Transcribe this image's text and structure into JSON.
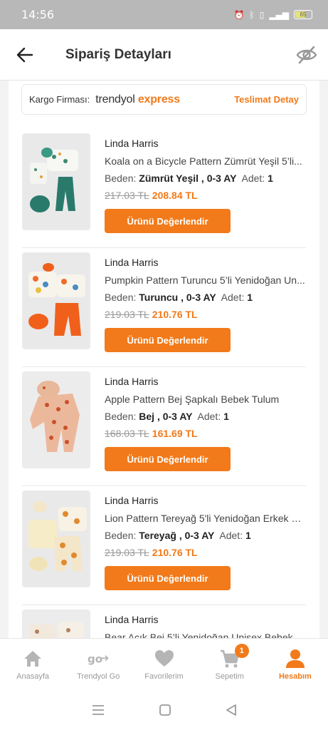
{
  "status_bar": {
    "time": "14:56",
    "battery": "65"
  },
  "header": {
    "title": "Sipariş Detayları"
  },
  "cargo": {
    "label": "Kargo Firması:",
    "brand_part1": "trendyol",
    "brand_part2": "express",
    "delivery_link": "Teslimat Detay"
  },
  "products": [
    {
      "seller": "Linda Harris",
      "name": "Koala on a Bicycle Pattern Zümrüt Yeşil 5’li...",
      "variant_label": "Beden:",
      "variant_value": "Zümrüt Yeşil , 0-3 AY",
      "qty_label": "Adet:",
      "qty_value": "1",
      "old_price": "217.03 TL",
      "new_price": "208.84 TL",
      "button": "Ürünü Değerlendir"
    },
    {
      "seller": "Linda Harris",
      "name": "Pumpkin Pattern Turuncu 5’li Yenidoğan Un...",
      "variant_label": "Beden:",
      "variant_value": "Turuncu , 0-3 AY",
      "qty_label": "Adet:",
      "qty_value": "1",
      "old_price": "219.03 TL",
      "new_price": "210.76 TL",
      "button": "Ürünü Değerlendir"
    },
    {
      "seller": "Linda Harris",
      "name": "Apple Pattern Bej Şapkalı Bebek Tulum",
      "variant_label": "Beden:",
      "variant_value": "Bej , 0-3 AY",
      "qty_label": "Adet:",
      "qty_value": "1",
      "old_price": "168.03 TL",
      "new_price": "161.69 TL",
      "button": "Ürünü Değerlendir"
    },
    {
      "seller": "Linda Harris",
      "name": "Lion Pattern Tereyağ 5'li Yenidoğan Erkek B...",
      "variant_label": "Beden:",
      "variant_value": "Tereyağ , 0-3 AY",
      "qty_label": "Adet:",
      "qty_value": "1",
      "old_price": "219.03 TL",
      "new_price": "210.76 TL",
      "button": "Ürünü Değerlendir"
    },
    {
      "seller": "Linda Harris",
      "name": "Bear Açık Bej 5’li Yenidoğan Unisex Bebek ..."
    }
  ],
  "bottom_nav": {
    "home": "Anasayfa",
    "go": "Trendyol Go",
    "favorites": "Favorilerim",
    "cart": "Sepetim",
    "cart_badge": "1",
    "account": "Hesabım"
  },
  "colors": {
    "accent": "#f27a1a",
    "status_bar": "#b8b8b8"
  },
  "icons": [
    "back-arrow-icon",
    "eye-off-icon",
    "home-icon",
    "trendyol-go-icon",
    "heart-icon",
    "cart-icon",
    "user-icon",
    "menu-icon",
    "square-icon",
    "back-triangle-icon"
  ]
}
